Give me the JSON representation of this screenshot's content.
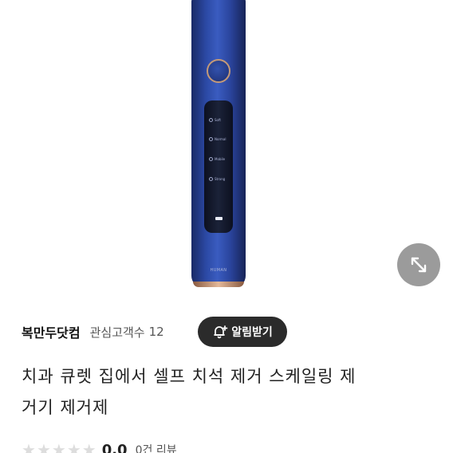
{
  "product_image": {
    "modes": [
      "Soft",
      "Normal",
      "Mobile",
      "Strong"
    ],
    "brand_mark": "HUMAN"
  },
  "seller": {
    "name": "복만두닷컴",
    "follower_label": "관심고객수",
    "follower_count": "12"
  },
  "alert_button": {
    "label": "알림받기"
  },
  "product": {
    "title_line1": "치과 큐렛 집에서 셀프 치석 제거 스케일링 제",
    "title_line2": "거기 제거제"
  },
  "rating": {
    "stars_filled": 0,
    "stars_total": 5,
    "value": "0.0",
    "review_count": "0건 리뷰"
  },
  "colors": {
    "brush_blue": "#2c4aa6",
    "alert_button_bg": "#2b2b2b",
    "expand_button_bg": "#9b9b9b",
    "star_empty": "#dddddd"
  }
}
